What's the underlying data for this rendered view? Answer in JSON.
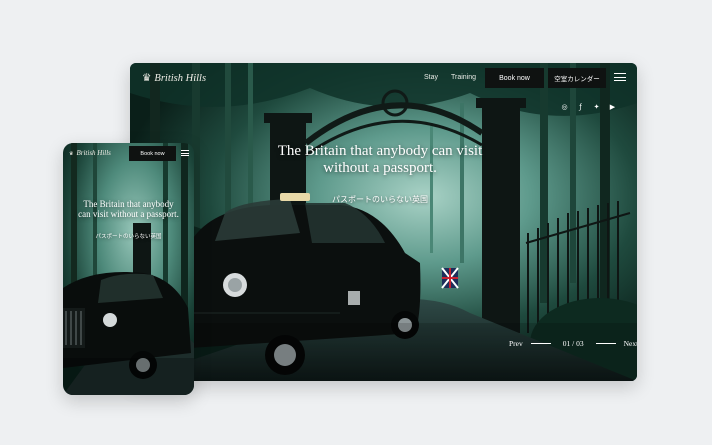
{
  "desktop": {
    "logo_text": "British Hills",
    "logo_icon": "crest-icon",
    "nav_links": [
      "Stay",
      "Training"
    ],
    "book_now_label": "Book now",
    "calendar_label": "空室カレンダー",
    "social_icons": [
      "instagram-icon",
      "facebook-icon",
      "twitter-icon",
      "youtube-icon"
    ],
    "hero_title_line1": "The Britain that anybody can visit",
    "hero_title_line2": "without a passport.",
    "hero_subtitle": "パスポートのいらない英国",
    "slider": {
      "prev_label": "Prev",
      "counter": "01 / 03",
      "next_label": "Next"
    }
  },
  "mobile": {
    "logo_text": "British Hills",
    "book_now_label": "Book now",
    "hero_title_line1": "The Britain that anybody",
    "hero_title_line2": "can visit without a passport.",
    "hero_subtitle": "パスポートのいらない英国"
  },
  "colors": {
    "background": "#eef0f2",
    "forest_dark": "#0b2a22",
    "forest_mist": "#7fb6a8",
    "button_bg": "#0f1211",
    "text_light": "#ffffff"
  }
}
